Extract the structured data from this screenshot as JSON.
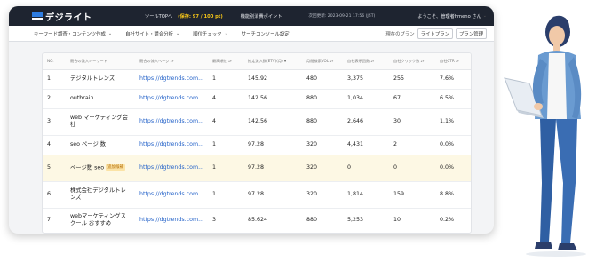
{
  "brand": {
    "name": "デジライト"
  },
  "topbar": {
    "home_label": "ツールTOPへ",
    "count_label": "(保存: 97 / 100 pt)",
    "points_label": "機能別消費ポイント",
    "date_label": "次回更新: 2023-09-21 17:56 (JST)",
    "user_label": "ようこそ、管理者hmeno さん"
  },
  "menu": {
    "items": [
      {
        "label": "キーワード調査・コンテンツ作成"
      },
      {
        "label": "自社サイト・競合分析"
      },
      {
        "label": "順位チェック"
      },
      {
        "label": "サーチコンソール設定"
      }
    ],
    "plan_label": "現在のプラン",
    "plan_value": "ライトプラン",
    "plan_manage": "プラン管理"
  },
  "table": {
    "headers": [
      "NO.",
      "競合の流入キーワード",
      "競合の流入ページ",
      "最高順位",
      "推定流入数(ETV)(月)",
      "月間検索VOL",
      "自社表示回数",
      "自社クリック数",
      "自社CTR"
    ],
    "rows": [
      {
        "no": "1",
        "keyword": "デジタルトレンズ",
        "badge": "",
        "page": "https://dgtrends.com...",
        "rank": "1",
        "etv": "145.92",
        "vol": "480",
        "impressions": "3,375",
        "clicks": "255",
        "ctr": "7.6%"
      },
      {
        "no": "2",
        "keyword": "outbrain",
        "badge": "",
        "page": "https://dgtrends.com...",
        "rank": "4",
        "etv": "142.56",
        "vol": "880",
        "impressions": "1,034",
        "clicks": "67",
        "ctr": "6.5%"
      },
      {
        "no": "3",
        "keyword": "web マーケティング会社",
        "badge": "",
        "page": "https://dgtrends.com...",
        "rank": "4",
        "etv": "142.56",
        "vol": "880",
        "impressions": "2,646",
        "clicks": "30",
        "ctr": "1.1%"
      },
      {
        "no": "4",
        "keyword": "seo ページ 数",
        "badge": "",
        "page": "https://dgtrends.com...",
        "rank": "1",
        "etv": "97.28",
        "vol": "320",
        "impressions": "4,431",
        "clicks": "2",
        "ctr": "0.0%"
      },
      {
        "no": "5",
        "keyword": "ページ数 seo",
        "badge": "追加候補",
        "page": "https://dgtrends.com...",
        "rank": "1",
        "etv": "97.28",
        "vol": "320",
        "impressions": "0",
        "clicks": "0",
        "ctr": "0.0%"
      },
      {
        "no": "6",
        "keyword": "株式会社デジタルトレンズ",
        "badge": "",
        "page": "https://dgtrends.com...",
        "rank": "1",
        "etv": "97.28",
        "vol": "320",
        "impressions": "1,814",
        "clicks": "159",
        "ctr": "8.8%"
      },
      {
        "no": "7",
        "keyword": "webマーケティングスクール おすすめ",
        "badge": "",
        "page": "https://dgtrends.com...",
        "rank": "3",
        "etv": "85.624",
        "vol": "880",
        "impressions": "5,253",
        "clicks": "10",
        "ctr": "0.2%"
      }
    ]
  },
  "colors": {
    "topbar_bg": "#1e2430",
    "accent": "#f5c518",
    "link": "#2563c9",
    "highlight_row": "#fdf8e4",
    "badge_bg": "#fbe3a6"
  },
  "icons": {
    "logo": "brand-logo-icon",
    "chevron": "chevron-down-icon",
    "sort": "sort-icon"
  }
}
